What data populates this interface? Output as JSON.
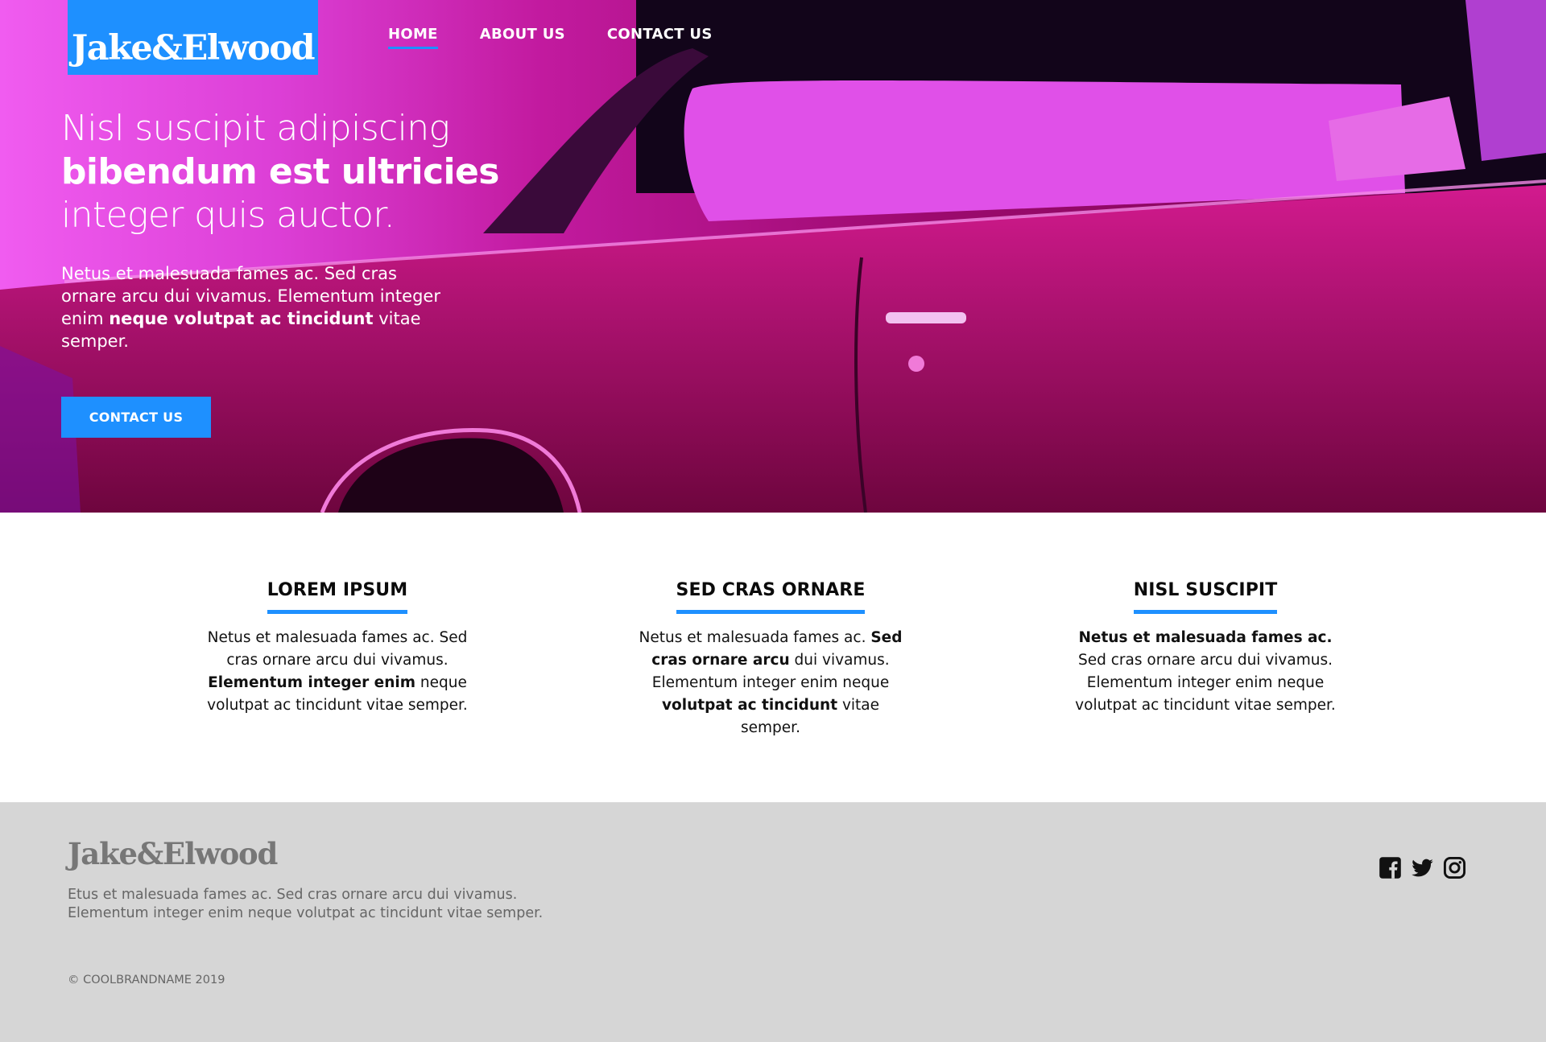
{
  "brand": {
    "name": "Jake&Elwood"
  },
  "nav": {
    "items": [
      {
        "label": "HOME",
        "active": true
      },
      {
        "label": "ABOUT US",
        "active": false
      },
      {
        "label": "CONTACT US",
        "active": false
      }
    ]
  },
  "hero": {
    "title_line1": "Nisl suscipit adipiscing",
    "title_line2": "bibendum est ultricies",
    "title_line3": "integer quis auctor.",
    "text_before": "Netus et malesuada fames ac. Sed cras ornare arcu dui vivamus. Elementum integer enim ",
    "text_bold": "neque volutpat ac tincidunt",
    "text_after": " vitae semper.",
    "cta_label": "CONTACT US"
  },
  "features": [
    {
      "title": "LOREM IPSUM",
      "p1": "Netus et malesuada fames ac. Sed cras ornare arcu dui vivamus. ",
      "b1": "Elementum integer enim",
      "p2": " neque volutpat ac tincidunt vitae semper."
    },
    {
      "title": "SED CRAS ORNARE",
      "p1": "Netus et malesuada fames ac. ",
      "b1": "Sed cras ornare arcu",
      "p2": " dui vivamus. Elementum integer enim neque ",
      "b2": "volutpat ac tincidunt",
      "p3": " vitae semper."
    },
    {
      "title": "NISL SUSCIPIT",
      "b1": "Netus et malesuada fames ac.",
      "p2": " Sed cras ornare arcu dui vivamus. Elementum integer enim neque volutpat ac tincidunt vitae semper."
    }
  ],
  "footer": {
    "logo": "Jake&Elwood",
    "text": "Etus et malesuada fames ac. Sed cras ornare arcu dui vivamus. Elementum integer enim neque volutpat ac tincidunt vitae semper.",
    "copyright": "© COOLBRANDNAME 2019",
    "social_icons": [
      "facebook-icon",
      "twitter-icon",
      "instagram-icon"
    ]
  },
  "colors": {
    "accent": "#1e90ff",
    "footer_bg": "#d6d6d6",
    "hero_magenta": "#c21a9f"
  }
}
